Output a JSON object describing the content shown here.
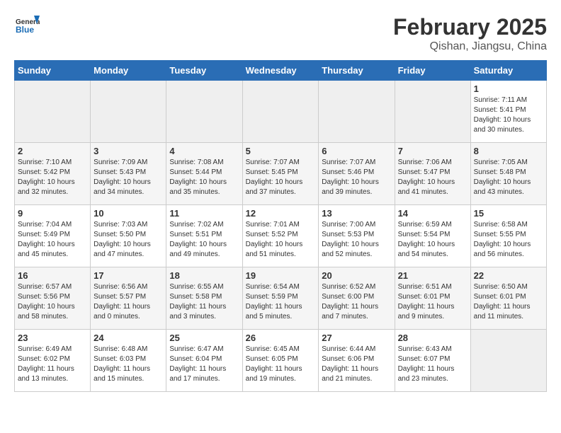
{
  "header": {
    "logo_line1": "General",
    "logo_line2": "Blue",
    "month": "February 2025",
    "location": "Qishan, Jiangsu, China"
  },
  "days_of_week": [
    "Sunday",
    "Monday",
    "Tuesday",
    "Wednesday",
    "Thursday",
    "Friday",
    "Saturday"
  ],
  "weeks": [
    [
      {
        "day": "",
        "info": ""
      },
      {
        "day": "",
        "info": ""
      },
      {
        "day": "",
        "info": ""
      },
      {
        "day": "",
        "info": ""
      },
      {
        "day": "",
        "info": ""
      },
      {
        "day": "",
        "info": ""
      },
      {
        "day": "1",
        "info": "Sunrise: 7:11 AM\nSunset: 5:41 PM\nDaylight: 10 hours\nand 30 minutes."
      }
    ],
    [
      {
        "day": "2",
        "info": "Sunrise: 7:10 AM\nSunset: 5:42 PM\nDaylight: 10 hours\nand 32 minutes."
      },
      {
        "day": "3",
        "info": "Sunrise: 7:09 AM\nSunset: 5:43 PM\nDaylight: 10 hours\nand 34 minutes."
      },
      {
        "day": "4",
        "info": "Sunrise: 7:08 AM\nSunset: 5:44 PM\nDaylight: 10 hours\nand 35 minutes."
      },
      {
        "day": "5",
        "info": "Sunrise: 7:07 AM\nSunset: 5:45 PM\nDaylight: 10 hours\nand 37 minutes."
      },
      {
        "day": "6",
        "info": "Sunrise: 7:07 AM\nSunset: 5:46 PM\nDaylight: 10 hours\nand 39 minutes."
      },
      {
        "day": "7",
        "info": "Sunrise: 7:06 AM\nSunset: 5:47 PM\nDaylight: 10 hours\nand 41 minutes."
      },
      {
        "day": "8",
        "info": "Sunrise: 7:05 AM\nSunset: 5:48 PM\nDaylight: 10 hours\nand 43 minutes."
      }
    ],
    [
      {
        "day": "9",
        "info": "Sunrise: 7:04 AM\nSunset: 5:49 PM\nDaylight: 10 hours\nand 45 minutes."
      },
      {
        "day": "10",
        "info": "Sunrise: 7:03 AM\nSunset: 5:50 PM\nDaylight: 10 hours\nand 47 minutes."
      },
      {
        "day": "11",
        "info": "Sunrise: 7:02 AM\nSunset: 5:51 PM\nDaylight: 10 hours\nand 49 minutes."
      },
      {
        "day": "12",
        "info": "Sunrise: 7:01 AM\nSunset: 5:52 PM\nDaylight: 10 hours\nand 51 minutes."
      },
      {
        "day": "13",
        "info": "Sunrise: 7:00 AM\nSunset: 5:53 PM\nDaylight: 10 hours\nand 52 minutes."
      },
      {
        "day": "14",
        "info": "Sunrise: 6:59 AM\nSunset: 5:54 PM\nDaylight: 10 hours\nand 54 minutes."
      },
      {
        "day": "15",
        "info": "Sunrise: 6:58 AM\nSunset: 5:55 PM\nDaylight: 10 hours\nand 56 minutes."
      }
    ],
    [
      {
        "day": "16",
        "info": "Sunrise: 6:57 AM\nSunset: 5:56 PM\nDaylight: 10 hours\nand 58 minutes."
      },
      {
        "day": "17",
        "info": "Sunrise: 6:56 AM\nSunset: 5:57 PM\nDaylight: 11 hours\nand 0 minutes."
      },
      {
        "day": "18",
        "info": "Sunrise: 6:55 AM\nSunset: 5:58 PM\nDaylight: 11 hours\nand 3 minutes."
      },
      {
        "day": "19",
        "info": "Sunrise: 6:54 AM\nSunset: 5:59 PM\nDaylight: 11 hours\nand 5 minutes."
      },
      {
        "day": "20",
        "info": "Sunrise: 6:52 AM\nSunset: 6:00 PM\nDaylight: 11 hours\nand 7 minutes."
      },
      {
        "day": "21",
        "info": "Sunrise: 6:51 AM\nSunset: 6:01 PM\nDaylight: 11 hours\nand 9 minutes."
      },
      {
        "day": "22",
        "info": "Sunrise: 6:50 AM\nSunset: 6:01 PM\nDaylight: 11 hours\nand 11 minutes."
      }
    ],
    [
      {
        "day": "23",
        "info": "Sunrise: 6:49 AM\nSunset: 6:02 PM\nDaylight: 11 hours\nand 13 minutes."
      },
      {
        "day": "24",
        "info": "Sunrise: 6:48 AM\nSunset: 6:03 PM\nDaylight: 11 hours\nand 15 minutes."
      },
      {
        "day": "25",
        "info": "Sunrise: 6:47 AM\nSunset: 6:04 PM\nDaylight: 11 hours\nand 17 minutes."
      },
      {
        "day": "26",
        "info": "Sunrise: 6:45 AM\nSunset: 6:05 PM\nDaylight: 11 hours\nand 19 minutes."
      },
      {
        "day": "27",
        "info": "Sunrise: 6:44 AM\nSunset: 6:06 PM\nDaylight: 11 hours\nand 21 minutes."
      },
      {
        "day": "28",
        "info": "Sunrise: 6:43 AM\nSunset: 6:07 PM\nDaylight: 11 hours\nand 23 minutes."
      },
      {
        "day": "",
        "info": ""
      }
    ]
  ]
}
